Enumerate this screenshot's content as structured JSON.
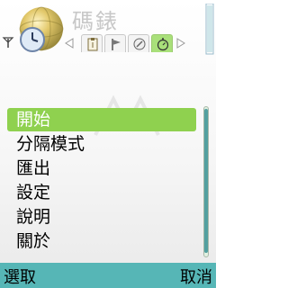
{
  "app": {
    "title": "碼錶"
  },
  "status": {
    "signal_icon": "antenna-signal-icon",
    "battery_icon": "battery-level-icon"
  },
  "tabs": [
    {
      "icon": "clipboard-icon",
      "active": false
    },
    {
      "icon": "flag-icon",
      "active": false
    },
    {
      "icon": "compass-icon",
      "active": false
    },
    {
      "icon": "stopwatch-icon",
      "active": true
    }
  ],
  "menu": {
    "items": [
      {
        "label": "開始",
        "highlighted": true
      },
      {
        "label": "分隔模式",
        "highlighted": false
      },
      {
        "label": "匯出",
        "highlighted": false
      },
      {
        "label": "設定",
        "highlighted": false
      },
      {
        "label": "說明",
        "highlighted": false
      },
      {
        "label": "關於",
        "highlighted": false
      }
    ]
  },
  "softkeys": {
    "left": "選取",
    "right": "取消"
  },
  "colors": {
    "highlight": "#8fd14f",
    "softkey_bar": "#56b6b6",
    "scroll_thumb": "#53a0a0"
  }
}
